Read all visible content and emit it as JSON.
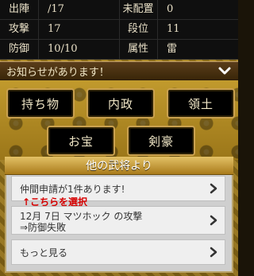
{
  "stats": {
    "rows": [
      {
        "left_label": "出陣",
        "left_value": "/17",
        "right_label": "未配置",
        "right_value": "0"
      },
      {
        "left_label": "攻撃",
        "left_value": "17",
        "right_label": "段位",
        "right_value": "11"
      },
      {
        "left_label": "防御",
        "left_value": "10/10",
        "right_label": "属性",
        "right_value": "雷"
      }
    ]
  },
  "announcement": {
    "text": "お知らせがあります！"
  },
  "buttons": {
    "inventory": "持ち物",
    "politics": "内政",
    "territory": "領土",
    "treasure": "お宝",
    "swordmaster": "剣豪"
  },
  "messages": {
    "title": "他の武将より",
    "items": [
      {
        "text": "仲間申請が1件あります!"
      },
      {
        "text": "12月 7日 マツホック の攻撃\n⇒防御失敗"
      },
      {
        "text": "もっと見る"
      }
    ],
    "hint": "↑こちらを選択"
  },
  "colors": {
    "gold": "#c19a2d",
    "panel": "#0f0f0f",
    "accent_red": "#d60000"
  }
}
